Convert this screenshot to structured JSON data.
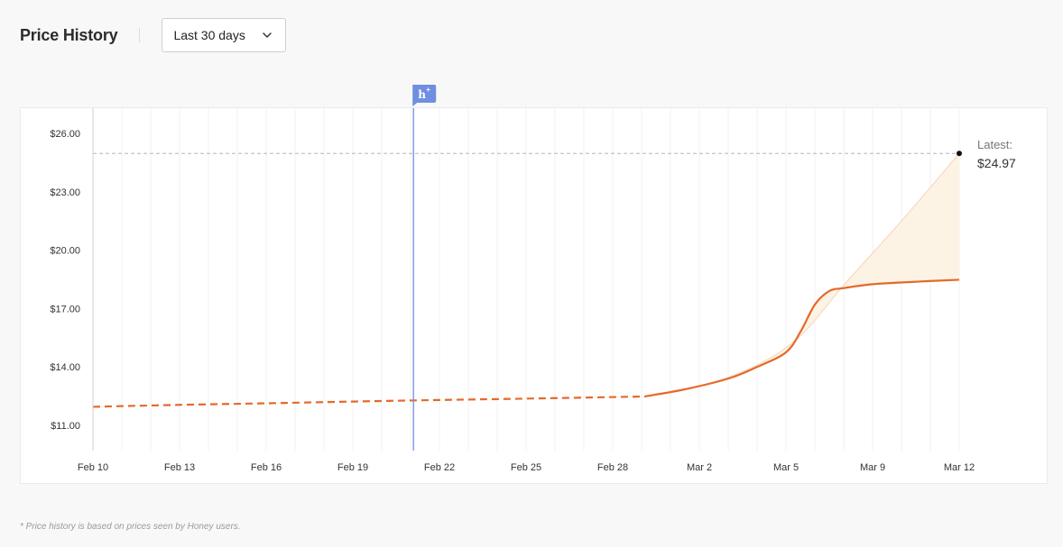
{
  "header": {
    "title": "Price History",
    "range_selected": "Last 30 days"
  },
  "chart_data": {
    "type": "line",
    "y_ticks": [
      "$26.00",
      "$23.00",
      "$20.00",
      "$17.00",
      "$14.00",
      "$11.00"
    ],
    "y_tick_values": [
      26,
      23,
      20,
      17,
      14,
      11
    ],
    "ylim": [
      9.7,
      27.3
    ],
    "x_ticks": [
      "Feb 10",
      "Feb 13",
      "Feb 16",
      "Feb 19",
      "Feb 22",
      "Feb 25",
      "Feb 28",
      "Mar 2",
      "Mar 5",
      "Mar 9",
      "Mar 12"
    ],
    "x_tick_days": [
      0,
      3,
      6,
      9,
      12,
      15,
      18,
      21,
      24,
      27,
      30
    ],
    "xlim_days": [
      0,
      30
    ],
    "grid": "vertical daily",
    "marker_day": 11.1,
    "marker_icon": "honey-h-icon",
    "series": [
      {
        "style": "dashed",
        "x_days": [
          0,
          3,
          6,
          9,
          12,
          15,
          19.1
        ],
        "y": [
          11.95,
          12.05,
          12.13,
          12.22,
          12.3,
          12.37,
          12.48
        ]
      },
      {
        "style": "solid",
        "x_days": [
          19.1,
          20.5,
          22,
          23,
          24,
          24.5,
          25,
          25.5,
          26,
          27,
          28.5,
          30
        ],
        "y": [
          12.48,
          12.85,
          13.4,
          14.0,
          14.75,
          15.8,
          17.2,
          17.9,
          18.05,
          18.25,
          18.38,
          18.48
        ]
      }
    ],
    "upper_band": {
      "x_days": [
        19.1,
        21,
        23,
        24.5,
        26,
        28,
        30
      ],
      "y": [
        12.48,
        13.0,
        14.1,
        15.6,
        18.2,
        21.5,
        24.97
      ]
    },
    "latest": {
      "label": "Latest:",
      "value_text": "$24.97",
      "value": 24.97,
      "day": 30
    },
    "colors": {
      "line": "#e5692b",
      "band_fill": "#fdf3e5",
      "band_edge": "#f8d9c0",
      "marker": "#6f8fe0",
      "grid": "#f0f0f0",
      "reference": "#b5b5b5"
    }
  },
  "footnote": "* Price history is based on prices seen by Honey users."
}
